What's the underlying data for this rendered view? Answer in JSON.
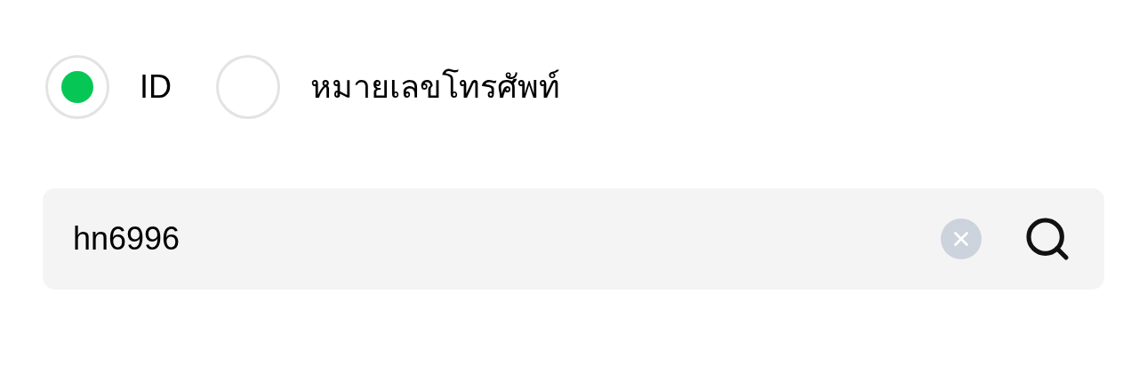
{
  "search_type": [
    {
      "label": "ID",
      "selected": true
    },
    {
      "label": "หมายเลขโทรศัพท์",
      "selected": false
    }
  ],
  "search": {
    "value": "hn6996"
  }
}
